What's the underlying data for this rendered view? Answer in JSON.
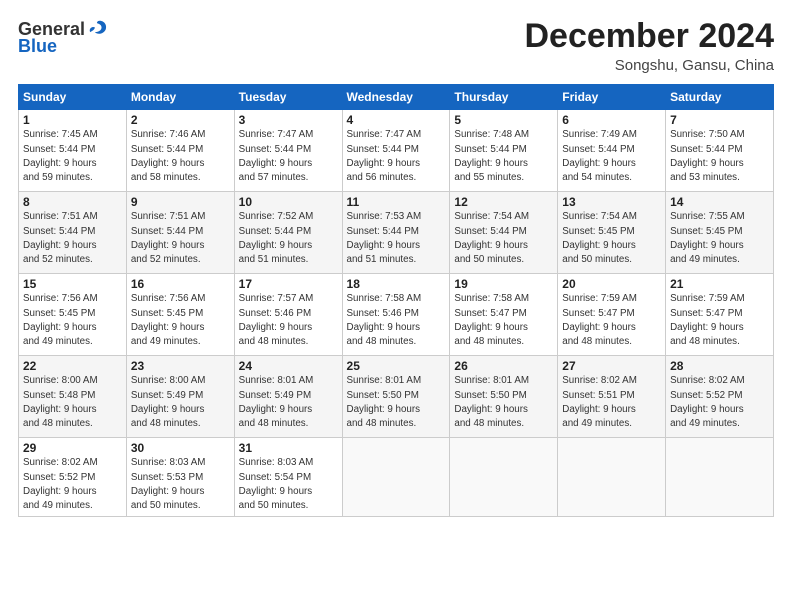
{
  "header": {
    "logo_general": "General",
    "logo_blue": "Blue",
    "month_title": "December 2024",
    "location": "Songshu, Gansu, China"
  },
  "weekdays": [
    "Sunday",
    "Monday",
    "Tuesday",
    "Wednesday",
    "Thursday",
    "Friday",
    "Saturday"
  ],
  "weeks": [
    [
      {
        "day": "1",
        "info": "Sunrise: 7:45 AM\nSunset: 5:44 PM\nDaylight: 9 hours\nand 59 minutes."
      },
      {
        "day": "2",
        "info": "Sunrise: 7:46 AM\nSunset: 5:44 PM\nDaylight: 9 hours\nand 58 minutes."
      },
      {
        "day": "3",
        "info": "Sunrise: 7:47 AM\nSunset: 5:44 PM\nDaylight: 9 hours\nand 57 minutes."
      },
      {
        "day": "4",
        "info": "Sunrise: 7:47 AM\nSunset: 5:44 PM\nDaylight: 9 hours\nand 56 minutes."
      },
      {
        "day": "5",
        "info": "Sunrise: 7:48 AM\nSunset: 5:44 PM\nDaylight: 9 hours\nand 55 minutes."
      },
      {
        "day": "6",
        "info": "Sunrise: 7:49 AM\nSunset: 5:44 PM\nDaylight: 9 hours\nand 54 minutes."
      },
      {
        "day": "7",
        "info": "Sunrise: 7:50 AM\nSunset: 5:44 PM\nDaylight: 9 hours\nand 53 minutes."
      }
    ],
    [
      {
        "day": "8",
        "info": "Sunrise: 7:51 AM\nSunset: 5:44 PM\nDaylight: 9 hours\nand 52 minutes."
      },
      {
        "day": "9",
        "info": "Sunrise: 7:51 AM\nSunset: 5:44 PM\nDaylight: 9 hours\nand 52 minutes."
      },
      {
        "day": "10",
        "info": "Sunrise: 7:52 AM\nSunset: 5:44 PM\nDaylight: 9 hours\nand 51 minutes."
      },
      {
        "day": "11",
        "info": "Sunrise: 7:53 AM\nSunset: 5:44 PM\nDaylight: 9 hours\nand 51 minutes."
      },
      {
        "day": "12",
        "info": "Sunrise: 7:54 AM\nSunset: 5:44 PM\nDaylight: 9 hours\nand 50 minutes."
      },
      {
        "day": "13",
        "info": "Sunrise: 7:54 AM\nSunset: 5:45 PM\nDaylight: 9 hours\nand 50 minutes."
      },
      {
        "day": "14",
        "info": "Sunrise: 7:55 AM\nSunset: 5:45 PM\nDaylight: 9 hours\nand 49 minutes."
      }
    ],
    [
      {
        "day": "15",
        "info": "Sunrise: 7:56 AM\nSunset: 5:45 PM\nDaylight: 9 hours\nand 49 minutes."
      },
      {
        "day": "16",
        "info": "Sunrise: 7:56 AM\nSunset: 5:45 PM\nDaylight: 9 hours\nand 49 minutes."
      },
      {
        "day": "17",
        "info": "Sunrise: 7:57 AM\nSunset: 5:46 PM\nDaylight: 9 hours\nand 48 minutes."
      },
      {
        "day": "18",
        "info": "Sunrise: 7:58 AM\nSunset: 5:46 PM\nDaylight: 9 hours\nand 48 minutes."
      },
      {
        "day": "19",
        "info": "Sunrise: 7:58 AM\nSunset: 5:47 PM\nDaylight: 9 hours\nand 48 minutes."
      },
      {
        "day": "20",
        "info": "Sunrise: 7:59 AM\nSunset: 5:47 PM\nDaylight: 9 hours\nand 48 minutes."
      },
      {
        "day": "21",
        "info": "Sunrise: 7:59 AM\nSunset: 5:47 PM\nDaylight: 9 hours\nand 48 minutes."
      }
    ],
    [
      {
        "day": "22",
        "info": "Sunrise: 8:00 AM\nSunset: 5:48 PM\nDaylight: 9 hours\nand 48 minutes."
      },
      {
        "day": "23",
        "info": "Sunrise: 8:00 AM\nSunset: 5:49 PM\nDaylight: 9 hours\nand 48 minutes."
      },
      {
        "day": "24",
        "info": "Sunrise: 8:01 AM\nSunset: 5:49 PM\nDaylight: 9 hours\nand 48 minutes."
      },
      {
        "day": "25",
        "info": "Sunrise: 8:01 AM\nSunset: 5:50 PM\nDaylight: 9 hours\nand 48 minutes."
      },
      {
        "day": "26",
        "info": "Sunrise: 8:01 AM\nSunset: 5:50 PM\nDaylight: 9 hours\nand 48 minutes."
      },
      {
        "day": "27",
        "info": "Sunrise: 8:02 AM\nSunset: 5:51 PM\nDaylight: 9 hours\nand 49 minutes."
      },
      {
        "day": "28",
        "info": "Sunrise: 8:02 AM\nSunset: 5:52 PM\nDaylight: 9 hours\nand 49 minutes."
      }
    ],
    [
      {
        "day": "29",
        "info": "Sunrise: 8:02 AM\nSunset: 5:52 PM\nDaylight: 9 hours\nand 49 minutes."
      },
      {
        "day": "30",
        "info": "Sunrise: 8:03 AM\nSunset: 5:53 PM\nDaylight: 9 hours\nand 50 minutes."
      },
      {
        "day": "31",
        "info": "Sunrise: 8:03 AM\nSunset: 5:54 PM\nDaylight: 9 hours\nand 50 minutes."
      },
      null,
      null,
      null,
      null
    ]
  ]
}
